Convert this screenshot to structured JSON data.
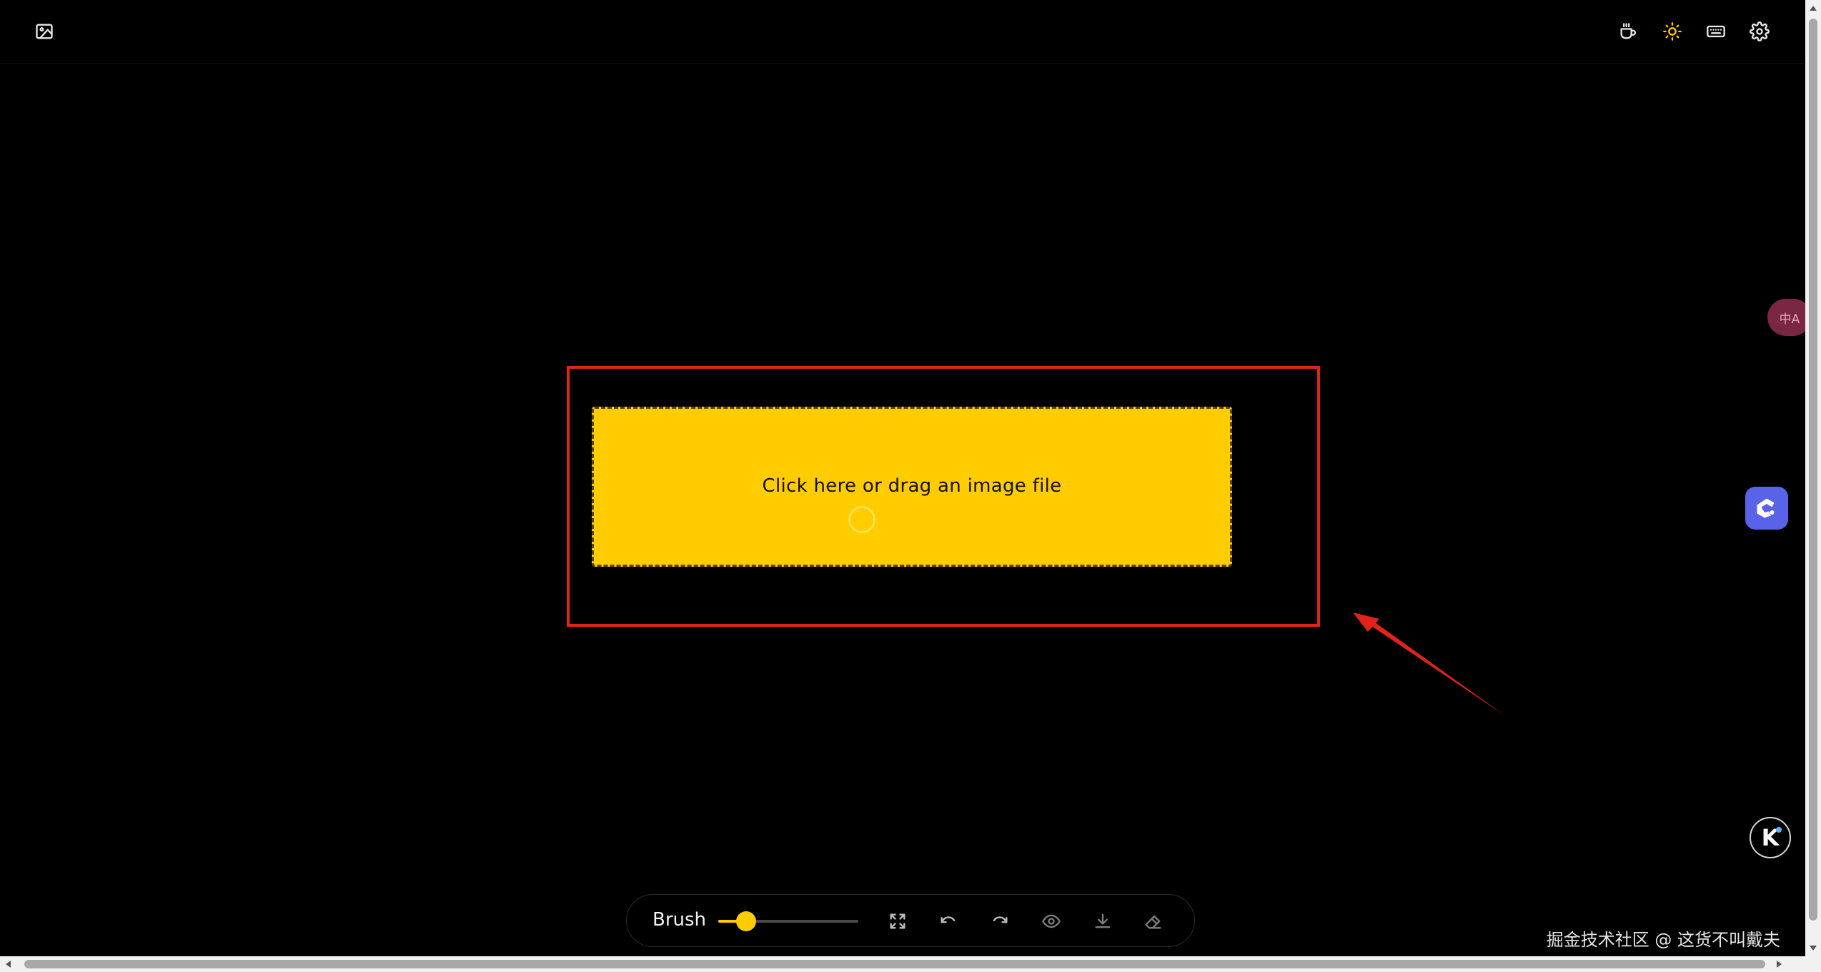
{
  "header": {
    "icons": {
      "image": "image-icon",
      "coffee": "coffee-icon",
      "theme": "sun-icon",
      "keyboard": "keyboard-icon",
      "settings": "gear-icon"
    }
  },
  "dropzone": {
    "label": "Click here or drag an image file",
    "color": "#ffcc00"
  },
  "toolbar": {
    "brush_label": "Brush",
    "brush_size_fraction": 0.2,
    "icons": [
      "fullscreen-icon",
      "undo-icon",
      "redo-icon",
      "eye-icon",
      "download-icon",
      "eraser-icon"
    ]
  },
  "floating": {
    "translate_label": "中A",
    "k_label": "K"
  },
  "watermark": "掘金技术社区 @ 这货不叫戴夫",
  "colors": {
    "accent": "#ffcc00",
    "annotation": "#e2231a",
    "background": "#000000"
  }
}
